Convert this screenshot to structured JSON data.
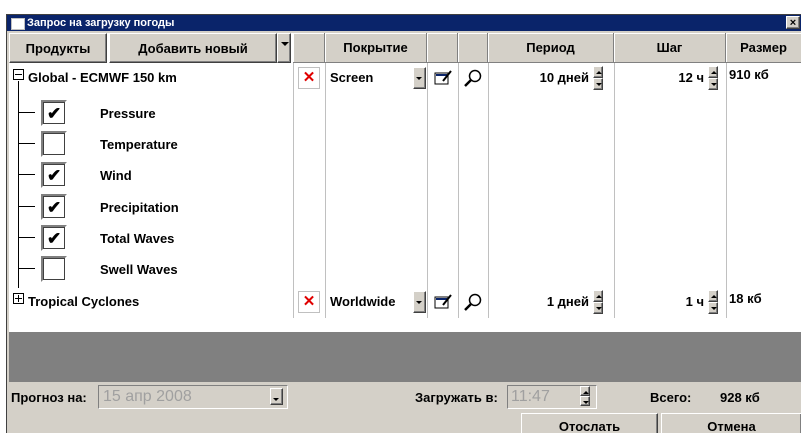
{
  "window": {
    "title": "Запрос на загрузку погоды",
    "close_glyph": "×"
  },
  "header": {
    "products": "Продукты",
    "add_new": "Добавить новый",
    "coverage": "Покрытие",
    "period": "Период",
    "step": "Шаг",
    "size": "Размер"
  },
  "groups": [
    {
      "name": "Global - ECMWF 150 km",
      "expanded": true,
      "coverage": "Screen",
      "period": "10 дней",
      "step": "12 ч",
      "size": "910 кб",
      "children": [
        {
          "label": "Pressure",
          "checked": true
        },
        {
          "label": "Temperature",
          "checked": false
        },
        {
          "label": "Wind",
          "checked": true
        },
        {
          "label": "Precipitation",
          "checked": true
        },
        {
          "label": "Total Waves",
          "checked": true
        },
        {
          "label": "Swell Waves",
          "checked": false
        }
      ]
    },
    {
      "name": "Tropical Cyclones",
      "expanded": false,
      "coverage": "Worldwide",
      "period": "1 дней",
      "step": "1 ч",
      "size": "18 кб"
    }
  ],
  "icons": {
    "delete": "delete-icon",
    "edit_area": "edit-area-icon",
    "preview": "magnifier-icon",
    "check": "✔"
  },
  "footer": {
    "forecast_label": "Прогноз на:",
    "forecast_value": "15 апр 2008",
    "download_label": "Загружать в:",
    "download_time": "11:47",
    "total_label": "Всего:",
    "total_value": "928 кб",
    "send": "Отослать",
    "cancel": "Отмена"
  },
  "colors": {
    "titlebar": "#0a246a",
    "face": "#d4d0c8",
    "delete_red": "#e00000",
    "band": "#808080"
  }
}
